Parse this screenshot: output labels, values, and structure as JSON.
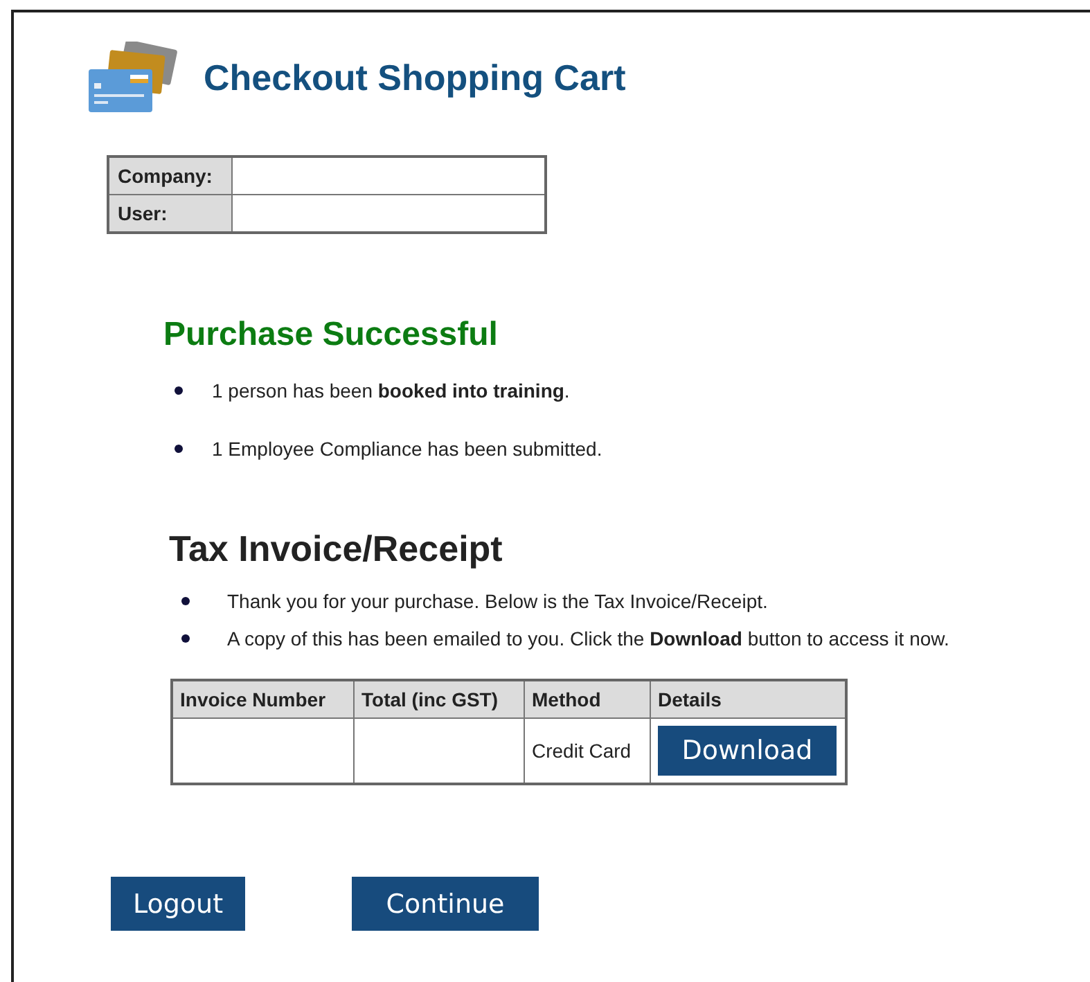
{
  "header": {
    "title": "Checkout Shopping Cart"
  },
  "account": [
    {
      "label": "Company:"
    },
    {
      "label": "User:"
    }
  ],
  "purchase": {
    "heading": "Purchase Successful",
    "items": [
      "1 person has been **booked into training**.",
      "1 Employee Compliance has been submitted."
    ]
  },
  "invoice": {
    "heading": "Tax Invoice/Receipt",
    "notes": [
      "Thank you for your purchase. Below is the Tax Invoice/Receipt.",
      "A copy of this has been emailed to you. Click the **Download**  button to access it now."
    ],
    "table": {
      "columns": [
        "Invoice Number",
        "Total (inc GST)",
        "Method",
        "Details"
      ],
      "rows": [
        {
          "method": "Credit Card",
          "details_button": "Download"
        }
      ]
    }
  },
  "buttons": [
    "Logout",
    "Continue"
  ]
}
